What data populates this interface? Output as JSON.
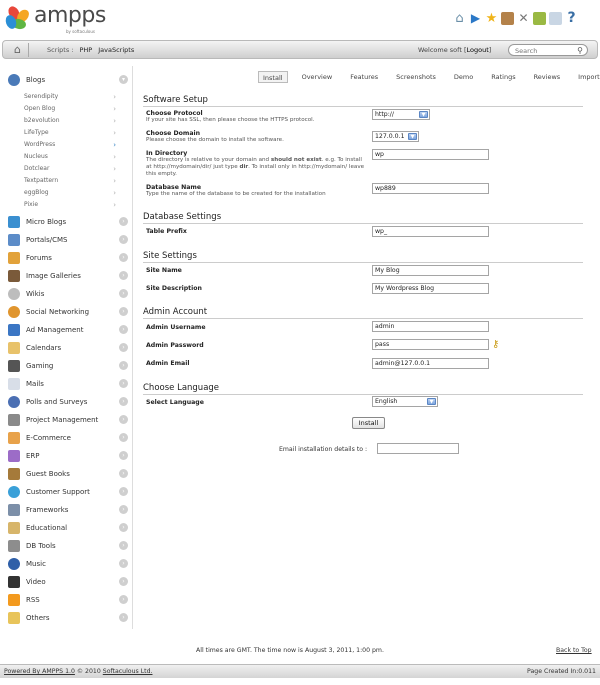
{
  "brand": {
    "name": "ampps",
    "tagline": "by softaculous"
  },
  "top_icons": [
    "home-icon",
    "play-icon",
    "star-icon",
    "database-icon",
    "tools-icon",
    "plugin-icon",
    "mail-icon",
    "help-icon"
  ],
  "nav": {
    "scripts_label": "Scripts :",
    "php": "PHP",
    "javascripts": "JavaScripts",
    "welcome_prefix": "Welcome soft [",
    "logout": "Logout",
    "welcome_suffix": "]",
    "search_placeholder": "Search"
  },
  "sidebar": {
    "blogs_label": "Blogs",
    "blog_scripts": [
      "Serendipity",
      "Open Blog",
      "b2evolution",
      "LifeType",
      "WordPress",
      "Nucleus",
      "Dotclear",
      "Textpattern",
      "eggBlog",
      "Pixie"
    ],
    "categories": [
      "Micro Blogs",
      "Portals/CMS",
      "Forums",
      "Image Galleries",
      "Wikis",
      "Social Networking",
      "Ad Management",
      "Calendars",
      "Gaming",
      "Mails",
      "Polls and Surveys",
      "Project Management",
      "E-Commerce",
      "ERP",
      "Guest Books",
      "Customer Support",
      "Frameworks",
      "Educational",
      "DB Tools",
      "Music",
      "Video",
      "RSS",
      "Others"
    ]
  },
  "tabs": [
    "Install",
    "Overview",
    "Features",
    "Screenshots",
    "Demo",
    "Ratings",
    "Reviews",
    "Import"
  ],
  "form": {
    "software_setup_title": "Software Setup",
    "protocol_label": "Choose Protocol",
    "protocol_help": "If your site has SSL, then please choose the HTTPS protocol.",
    "protocol_value": "http://",
    "domain_label": "Choose Domain",
    "domain_help": "Please choose the domain to install the software.",
    "domain_value": "127.0.0.1",
    "directory_label": "In Directory",
    "directory_help_1": "The directory is relative to your domain and ",
    "directory_help_bold": "should not exist",
    "directory_help_2": ". e.g. To install at http://mydomain/dir/ just type ",
    "directory_help_dir": "dir",
    "directory_help_3": ". To install only in http://mydomain/ leave this empty.",
    "directory_value": "wp",
    "dbname_label": "Database Name",
    "dbname_help": "Type the name of the database to be created for the installation",
    "dbname_value": "wp889",
    "db_settings_title": "Database Settings",
    "prefix_label": "Table Prefix",
    "prefix_value": "wp_",
    "site_settings_title": "Site Settings",
    "site_name_label": "Site Name",
    "site_name_value": "My Blog",
    "site_desc_label": "Site Description",
    "site_desc_value": "My Wordpress Blog",
    "admin_title": "Admin Account",
    "admin_user_label": "Admin Username",
    "admin_user_value": "admin",
    "admin_pass_label": "Admin Password",
    "admin_pass_value": "pass",
    "admin_email_label": "Admin Email",
    "admin_email_value": "admin@127.0.0.1",
    "language_title": "Choose Language",
    "language_label": "Select Language",
    "language_value": "English",
    "install_button": "Install",
    "email_label": "Email installation details to :"
  },
  "footer": {
    "time_note": "All times are GMT. The time now is August 3, 2011, 1:00 pm.",
    "back_to_top": "Back to Top",
    "powered_by": "Powered By AMPPS 1.0",
    "copyright_year": "© 2010",
    "company": "Softaculous Ltd.",
    "page_created": "Page Created In:0.011"
  },
  "colors": {
    "accent_blue": "#2d7fc1",
    "nav_gradient_top": "#f4f4f4",
    "nav_gradient_bottom": "#cfcfcf"
  }
}
